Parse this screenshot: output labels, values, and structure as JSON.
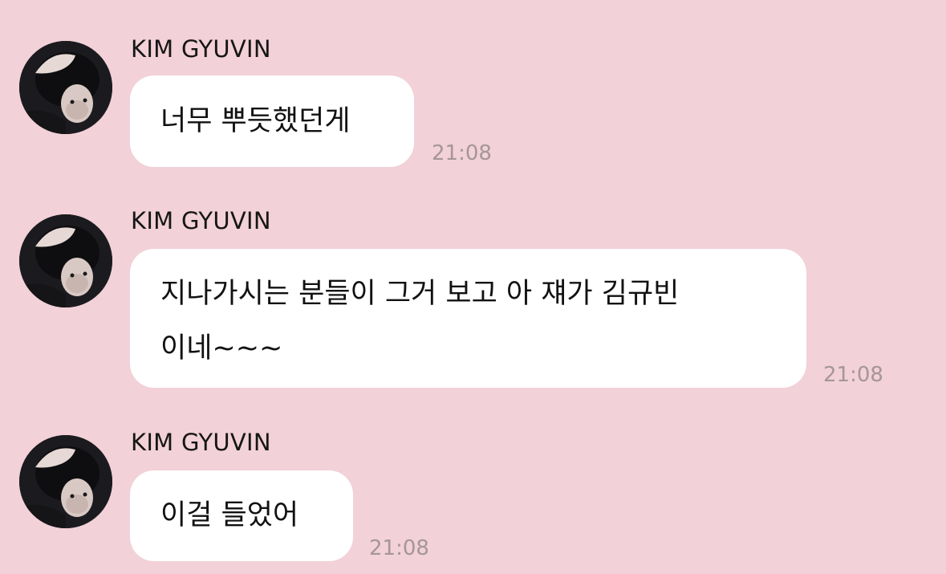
{
  "colors": {
    "background": "#f2d1d8",
    "bubble": "#ffffff",
    "timestamp": "#a5969a"
  },
  "messages": [
    {
      "sender": "KIM GYUVIN",
      "avatar_icon": "profile-photo-avatar",
      "text": "너무 뿌듯했던게",
      "time": "21:08"
    },
    {
      "sender": "KIM GYUVIN",
      "avatar_icon": "profile-photo-avatar",
      "text_lines": [
        "지나가시는 분들이 그거 보고 아 쟤가 김규빈",
        "이네~~~"
      ],
      "time": "21:08"
    },
    {
      "sender": "KIM GYUVIN",
      "avatar_icon": "profile-photo-avatar",
      "text": "이걸 들었어",
      "time": "21:08"
    }
  ]
}
